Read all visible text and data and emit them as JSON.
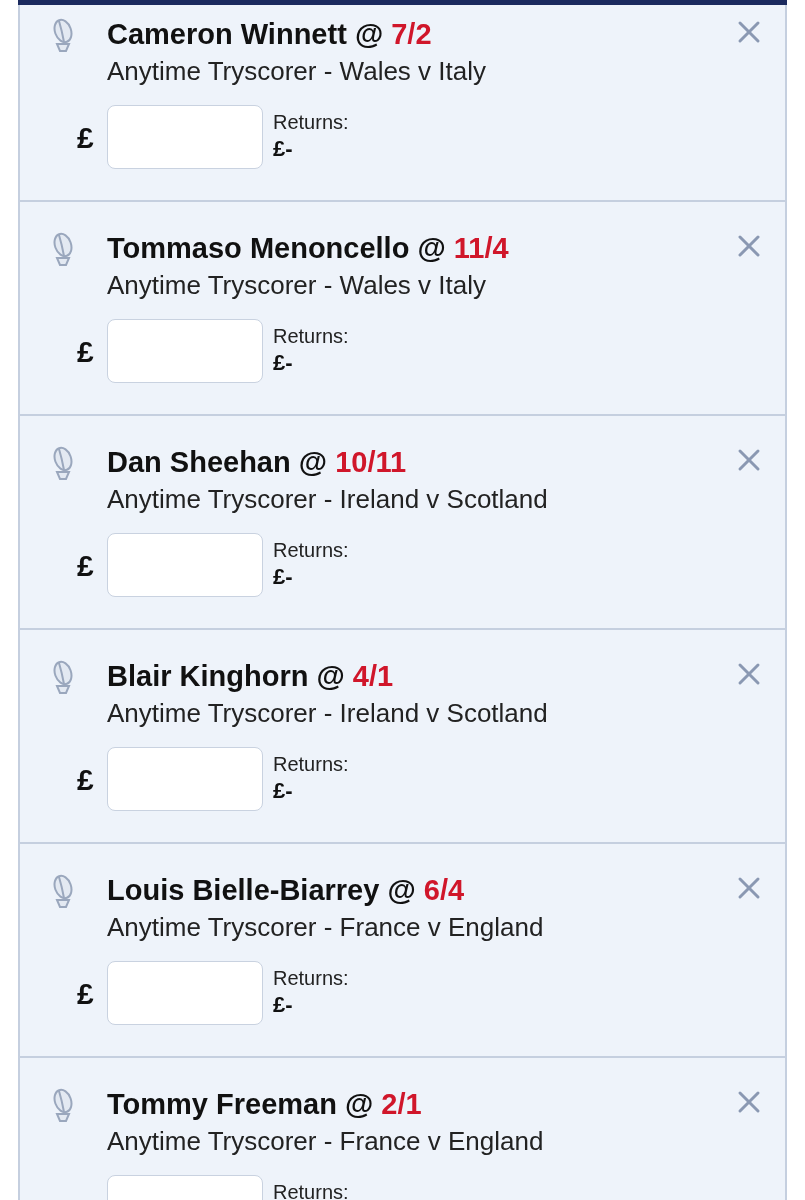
{
  "bets": [
    {
      "selection": "Cameron Winnett",
      "at": "@",
      "odds": "7/2",
      "market": "Anytime Tryscorer - Wales v Italy",
      "currency": "£",
      "returns_label": "Returns:",
      "returns_value": "£-"
    },
    {
      "selection": "Tommaso Menoncello",
      "at": "@",
      "odds": "11/4",
      "market": "Anytime Tryscorer - Wales v Italy",
      "currency": "£",
      "returns_label": "Returns:",
      "returns_value": "£-"
    },
    {
      "selection": "Dan Sheehan",
      "at": "@",
      "odds": "10/11",
      "market": "Anytime Tryscorer - Ireland v Scotland",
      "currency": "£",
      "returns_label": "Returns:",
      "returns_value": "£-"
    },
    {
      "selection": "Blair Kinghorn",
      "at": "@",
      "odds": "4/1",
      "market": "Anytime Tryscorer - Ireland v Scotland",
      "currency": "£",
      "returns_label": "Returns:",
      "returns_value": "£-"
    },
    {
      "selection": "Louis Bielle-Biarrey",
      "at": "@",
      "odds": "6/4",
      "market": "Anytime Tryscorer - France v England",
      "currency": "£",
      "returns_label": "Returns:",
      "returns_value": "£-"
    },
    {
      "selection": "Tommy Freeman",
      "at": "@",
      "odds": "2/1",
      "market": "Anytime Tryscorer - France v England",
      "returns_label": "Returns:"
    }
  ]
}
